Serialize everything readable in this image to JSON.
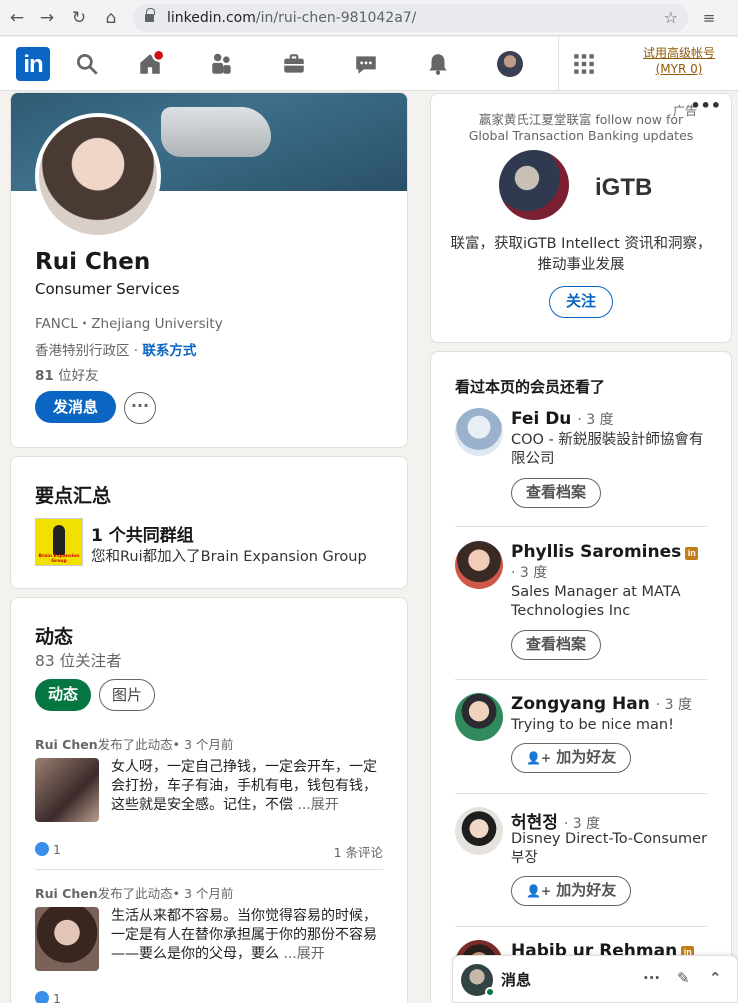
{
  "browser": {
    "url_host": "linkedin.com",
    "url_path": "/in/rui-chen-981042a7/"
  },
  "header": {
    "logo": "in",
    "premium_line1": "试用高级帐号",
    "premium_line2": "(MYR 0)"
  },
  "profile": {
    "name": "Rui Chen",
    "headline": "Consumer Services",
    "company_edu": "FANCL・Zhejiang University",
    "location": "香港特别行政区",
    "contact_link": "联系方式",
    "connections_count": "81",
    "connections_label": " 位好友",
    "message_button": "发消息",
    "more_button": "···"
  },
  "highlights": {
    "title": "要点汇总",
    "item_title": "1 个共同群组",
    "item_desc": "您和Rui都加入了Brain Expansion Group",
    "group_caption": "Brain Expansion Group"
  },
  "activity": {
    "title": "动态",
    "followers": "83 位关注者",
    "tabs": [
      "动态",
      "图片"
    ],
    "posts": [
      {
        "author": "Rui Chen",
        "action": "发布了此动态• 3 个月前",
        "text": "女人呀，一定自己挣钱，一定会开车，一定会打扮，车子有油，手机有电，钱包有钱，这些就是安全感。记住，不偿",
        "more": "...展开",
        "likes": "1",
        "comments": "1 条评论"
      },
      {
        "author": "Rui Chen",
        "action": "发布了此动态• 3 个月前",
        "text": "生活从来都不容易。当你觉得容易的时候，一定是有人在替你承担属于你的那份不容易——要么是你的父母，要么",
        "more": "...展开",
        "likes": "1"
      }
    ]
  },
  "ad": {
    "label": "广告",
    "dots": "•••",
    "subtitle": "赢家黄氏江夏堂联富 follow now for Global Transaction Banking updates",
    "logo": "iGTB",
    "text": "联富，获取iGTB Intellect 资讯和洞察，推动事业发展",
    "follow_button": "关注"
  },
  "pymk": {
    "title": "看过本页的会员还看了",
    "people": [
      {
        "name": "Fei Du",
        "degree": "· 3 度",
        "desc": "COO - 新鋭服裝設計師協會有限公司",
        "button": "查看档案"
      },
      {
        "name": "Phyllis Saromines",
        "degree": "· 3 度",
        "desc": "Sales Manager at MATA Technologies Inc",
        "button": "查看档案"
      },
      {
        "name": "Zongyang Han",
        "degree": "· 3 度",
        "desc": "Trying to be nice man!",
        "button": "加为好友"
      },
      {
        "name": "허현정",
        "degree": "· 3 度",
        "desc": "Disney Direct-To-Consumer 부장",
        "button": "加为好友"
      },
      {
        "name": "Habib ur Rehman",
        "degree": "",
        "desc": "",
        "button": ""
      }
    ]
  },
  "messaging": {
    "label": "消息"
  },
  "colors": {
    "linkedin_blue": "#0a66c2",
    "green_active": "#057642",
    "premium_gold": "#915907"
  }
}
